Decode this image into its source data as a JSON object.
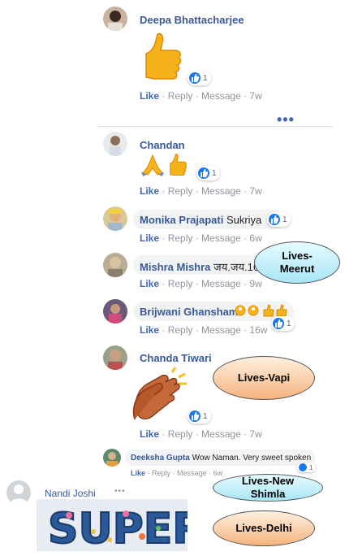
{
  "actions": {
    "like": "Like",
    "reply": "Reply",
    "message": "Message"
  },
  "comments": [
    {
      "name": "Deepa Bhattacharjee",
      "text": "",
      "reactions": "1",
      "time": "7w"
    },
    {
      "name": "Chandan",
      "text": "",
      "reactions": "1",
      "time": "7w"
    },
    {
      "name": "Monika Prajapati",
      "text": "Sukriya",
      "reactions": "1",
      "time": "6w"
    },
    {
      "name": "Mishra Mishra",
      "text": "जय.जय.16",
      "reactions": "",
      "time": "9w"
    },
    {
      "name": "Brijwani Ghansham",
      "text": "",
      "reactions": "1",
      "time": "16w"
    },
    {
      "name": "Chanda Tiwari",
      "text": "",
      "reactions": "1",
      "time": "7w"
    },
    {
      "name": "Deeksha Gupta",
      "text": "Wow Naman. Very sweet spoken",
      "reactions": "1",
      "time": "6w"
    },
    {
      "name": "Nandi Joshi",
      "text": "",
      "reactions": "",
      "time": ""
    }
  ],
  "callouts": [
    {
      "label": "Lives-Meerut",
      "style": "blue"
    },
    {
      "label": "Lives-Vapi",
      "style": "orange"
    },
    {
      "label": "Lives-New Shimla",
      "style": "blue"
    },
    {
      "label": "Lives-Delhi",
      "style": "orange"
    }
  ],
  "sticker": {
    "text": "SUPER"
  },
  "colors": {
    "name": "#385898",
    "like": "#4267b2",
    "meta": "#90949c",
    "bubble": "#f2f3f5",
    "reaction": "#1877f2"
  }
}
